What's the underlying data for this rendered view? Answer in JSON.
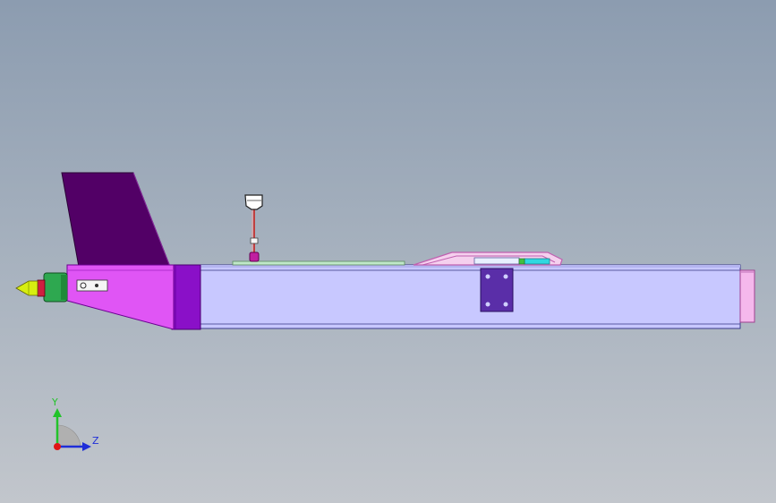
{
  "triad": {
    "y_label": "Y",
    "z_label": "Z",
    "y_color": "#22c32a",
    "z_color": "#1f2ed8",
    "x_color": "#e01515"
  },
  "colors": {
    "background_top": "#8c9cb0",
    "background_bottom": "#c2c6cc",
    "fuselage": "#c8c8ff",
    "nose_section": "#e055f5",
    "fin": "#520066",
    "collar": "#8a10c8",
    "mount_plate": "#5a2ea8",
    "spinner": "#d7ee10",
    "motor": "#2ea850",
    "tail_cap": "#f5b8ec",
    "wing_outline": "#f0a8e0"
  }
}
